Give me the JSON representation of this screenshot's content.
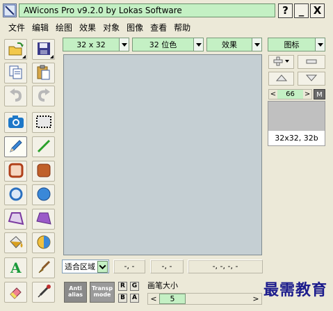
{
  "window": {
    "title": "AWicons Pro v9.2.0 by Lokas Software",
    "help_btn": "?",
    "min_btn": "_",
    "close_btn": "X"
  },
  "menu": [
    "文件",
    "编辑",
    "绘图",
    "效果",
    "对象",
    "图像",
    "查看",
    "帮助"
  ],
  "toolbar_top": {
    "size": "32 x 32",
    "color_depth": "32 位色",
    "effects": "效果",
    "icon_dropdown": "图标"
  },
  "tools": [
    {
      "row": 1,
      "left": "open-folder-icon",
      "right": "save-icon"
    },
    {
      "row": 2,
      "left": "copy-icon",
      "right": "paste-icon"
    },
    {
      "row": 3,
      "left": "undo-icon",
      "right": "redo-icon"
    },
    {
      "row": 4,
      "left": "camera-icon",
      "right": "select-rect-icon"
    },
    {
      "row": 5,
      "left": "pencil-icon",
      "right": "line-icon"
    },
    {
      "row": 6,
      "left": "rounded-rect-outline-icon",
      "right": "rounded-rect-filled-icon"
    },
    {
      "row": 7,
      "left": "ellipse-outline-icon",
      "right": "ellipse-filled-icon"
    },
    {
      "row": 8,
      "left": "polygon-outline-icon",
      "right": "polygon-filled-icon"
    },
    {
      "row": 9,
      "left": "fill-bucket-icon",
      "right": "gradient-icon"
    },
    {
      "row": 10,
      "left": "text-icon",
      "right": "brush-icon"
    },
    {
      "row": 11,
      "left": "eraser-icon",
      "right": "eyedropper-icon"
    }
  ],
  "status": {
    "zoom_select": "适合区域",
    "coord1": "-, -",
    "coord2": "-, -",
    "coord3": "-, -, -, -",
    "brush_size_label": "画笔大小",
    "brush_size_value": "5",
    "antialias_label": "Anti alias",
    "transp_label": "Transp mode",
    "btn_r": "R",
    "btn_g": "G",
    "btn_b": "B",
    "btn_a": "A",
    "spin_left": "<",
    "spin_right": ">"
  },
  "right_panel": {
    "frame_number": "66",
    "frame_m": "M",
    "spin_left": "<",
    "spin_right": ">",
    "thumb_label": "32x32, 32b"
  },
  "watermark": "最需教育",
  "colors": {
    "accent_green": "#c4f0c4",
    "canvas": "#c5cfd3",
    "window_bg": "#ece9d8"
  }
}
